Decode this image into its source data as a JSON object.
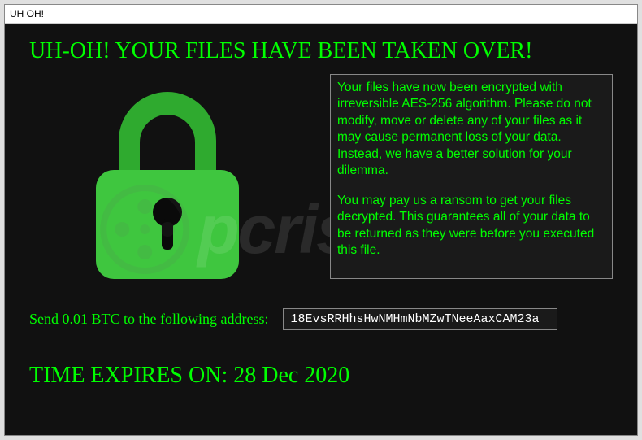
{
  "window": {
    "title": "UH OH!"
  },
  "headline": "UH-OH! YOUR FILES HAVE BEEN TAKEN OVER!",
  "message": {
    "paragraph1": "Your files have now been encrypted with irreversible AES-256 algorithm. Please do not modify, move or delete any of your files as it may cause permanent loss of your data. Instead, we have a better solution for your dilemma.",
    "paragraph2": "You may pay us a ransom to get your files decrypted. This guarantees all of your data to be returned as they were before you executed this file."
  },
  "payment": {
    "label": "Send 0.01 BTC to the following address:",
    "address": "18EvsRRHhsHwNMHmNbMZwTNeeAaxCAM23a"
  },
  "expiry": {
    "label_prefix": "TIME EXPIRES ON:  ",
    "date": "28 Dec 2020"
  },
  "watermark": {
    "text": "pcrisk.com"
  },
  "colors": {
    "accent": "#00ff00",
    "background": "#111111"
  }
}
